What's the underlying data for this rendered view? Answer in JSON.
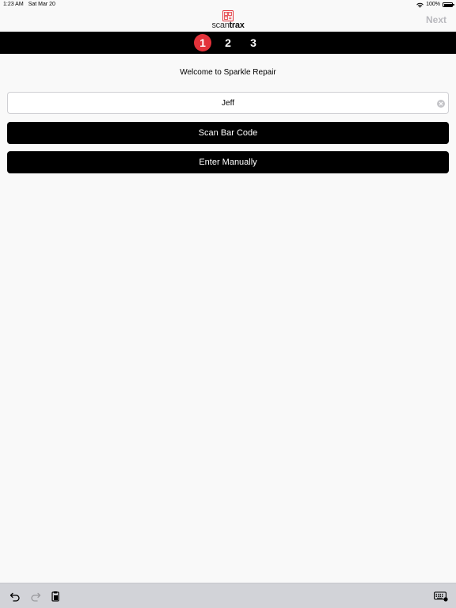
{
  "status_bar": {
    "time": "1:23 AM",
    "date": "Sat Mar 20",
    "battery_text": "100%",
    "battery_level": 1.0,
    "icons": [
      "wifi-icon",
      "battery-icon"
    ]
  },
  "header": {
    "logo_scan": "scan",
    "logo_trax": "trax",
    "next_label": "Next"
  },
  "steps": [
    {
      "label": "1",
      "active": true
    },
    {
      "label": "2",
      "active": false
    },
    {
      "label": "3",
      "active": false
    }
  ],
  "main": {
    "welcome_text": "Welcome to Sparkle Repair",
    "name_value": "Jeff",
    "scan_label": "Scan Bar Code",
    "manual_label": "Enter Manually"
  },
  "bottom_bar": {
    "icons": [
      "undo-icon",
      "redo-icon",
      "paste-icon",
      "keyboard-dismiss-icon"
    ]
  },
  "colors": {
    "accent": "#e3323a",
    "bar_background": "#000000",
    "next_disabled": "#b9b9be",
    "page_background": "#f9f9f9"
  }
}
